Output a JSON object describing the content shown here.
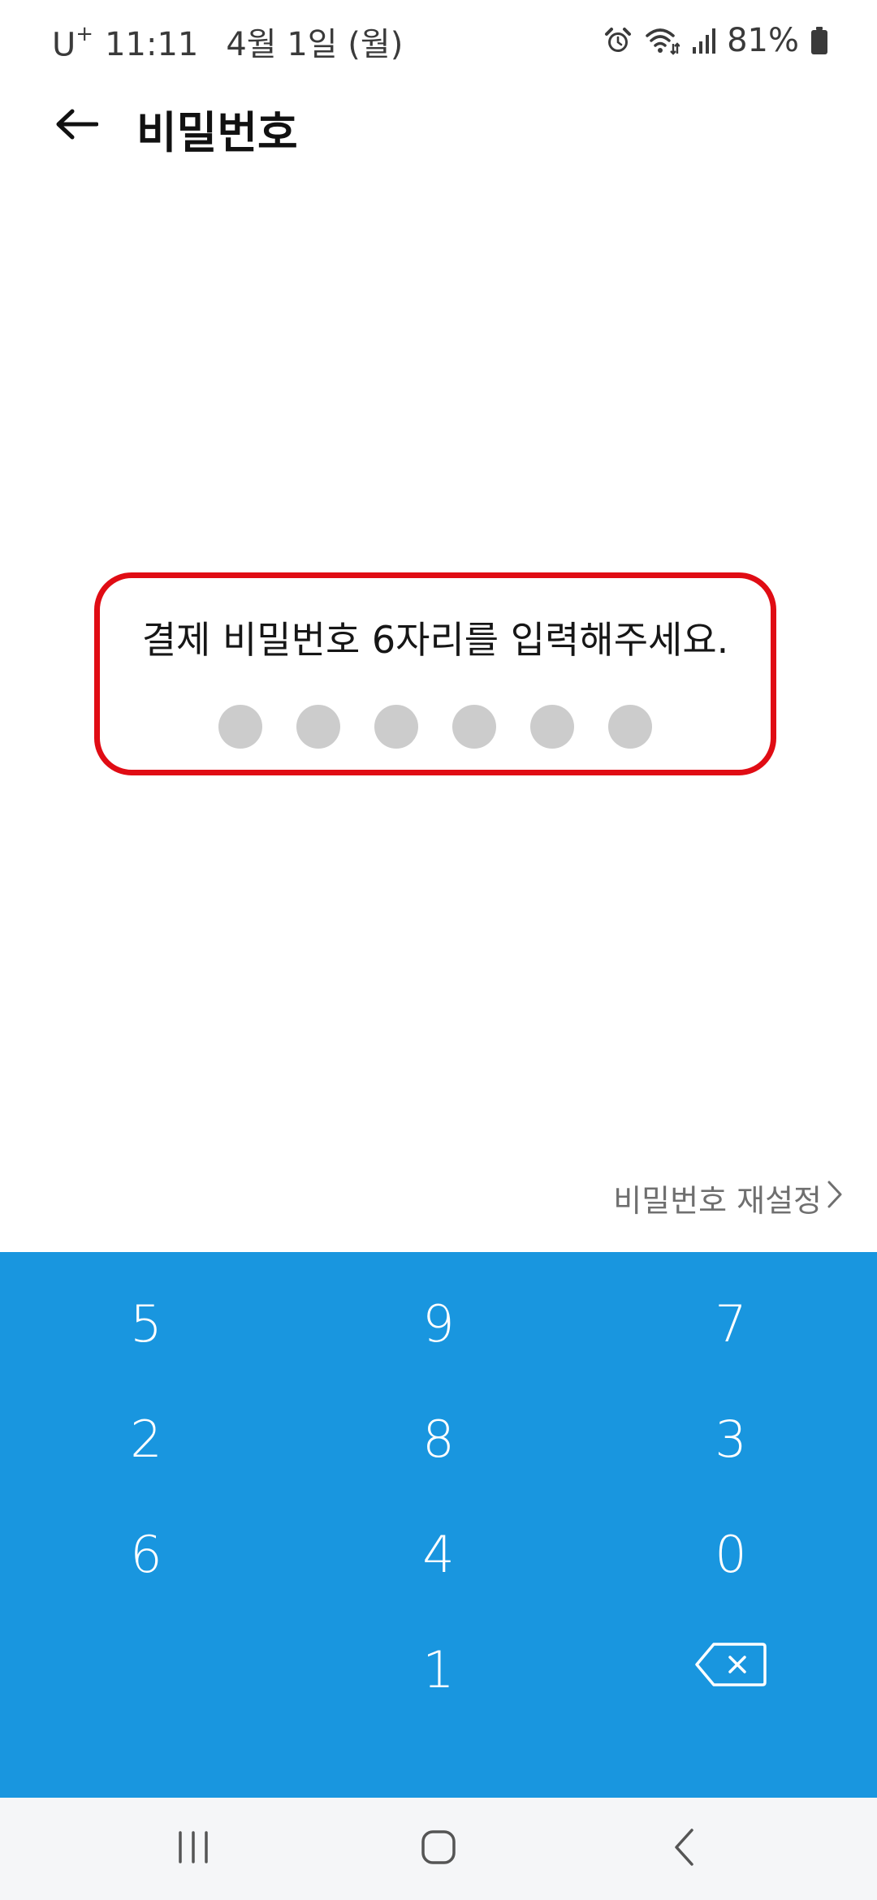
{
  "status_bar": {
    "carrier": "U",
    "carrier_sup": "+",
    "time": "11:11",
    "date": "4월 1일 (월)",
    "battery": "81%",
    "icons": [
      "alarm-icon",
      "wifi-icon",
      "signal-icon",
      "battery-icon"
    ]
  },
  "header": {
    "title": "비밀번호",
    "back_icon": "arrow-left-icon"
  },
  "password": {
    "prompt": "결제 비밀번호 6자리를 입력해주세요.",
    "entered": 0,
    "length": 6
  },
  "reset_link": {
    "label": "비밀번호 재설정",
    "icon": "chevron-right-icon"
  },
  "keypad": {
    "keys": [
      "5",
      "9",
      "7",
      "2",
      "8",
      "3",
      "6",
      "4",
      "0",
      "",
      "1",
      "backspace"
    ],
    "backspace_icon": "backspace-icon"
  },
  "nav_bar": {
    "items": [
      "recent-apps-icon",
      "home-icon",
      "back-icon"
    ]
  },
  "colors": {
    "keypad_bg": "#1996df",
    "highlight_border": "#e00c14",
    "dot_empty": "#cccccc"
  }
}
